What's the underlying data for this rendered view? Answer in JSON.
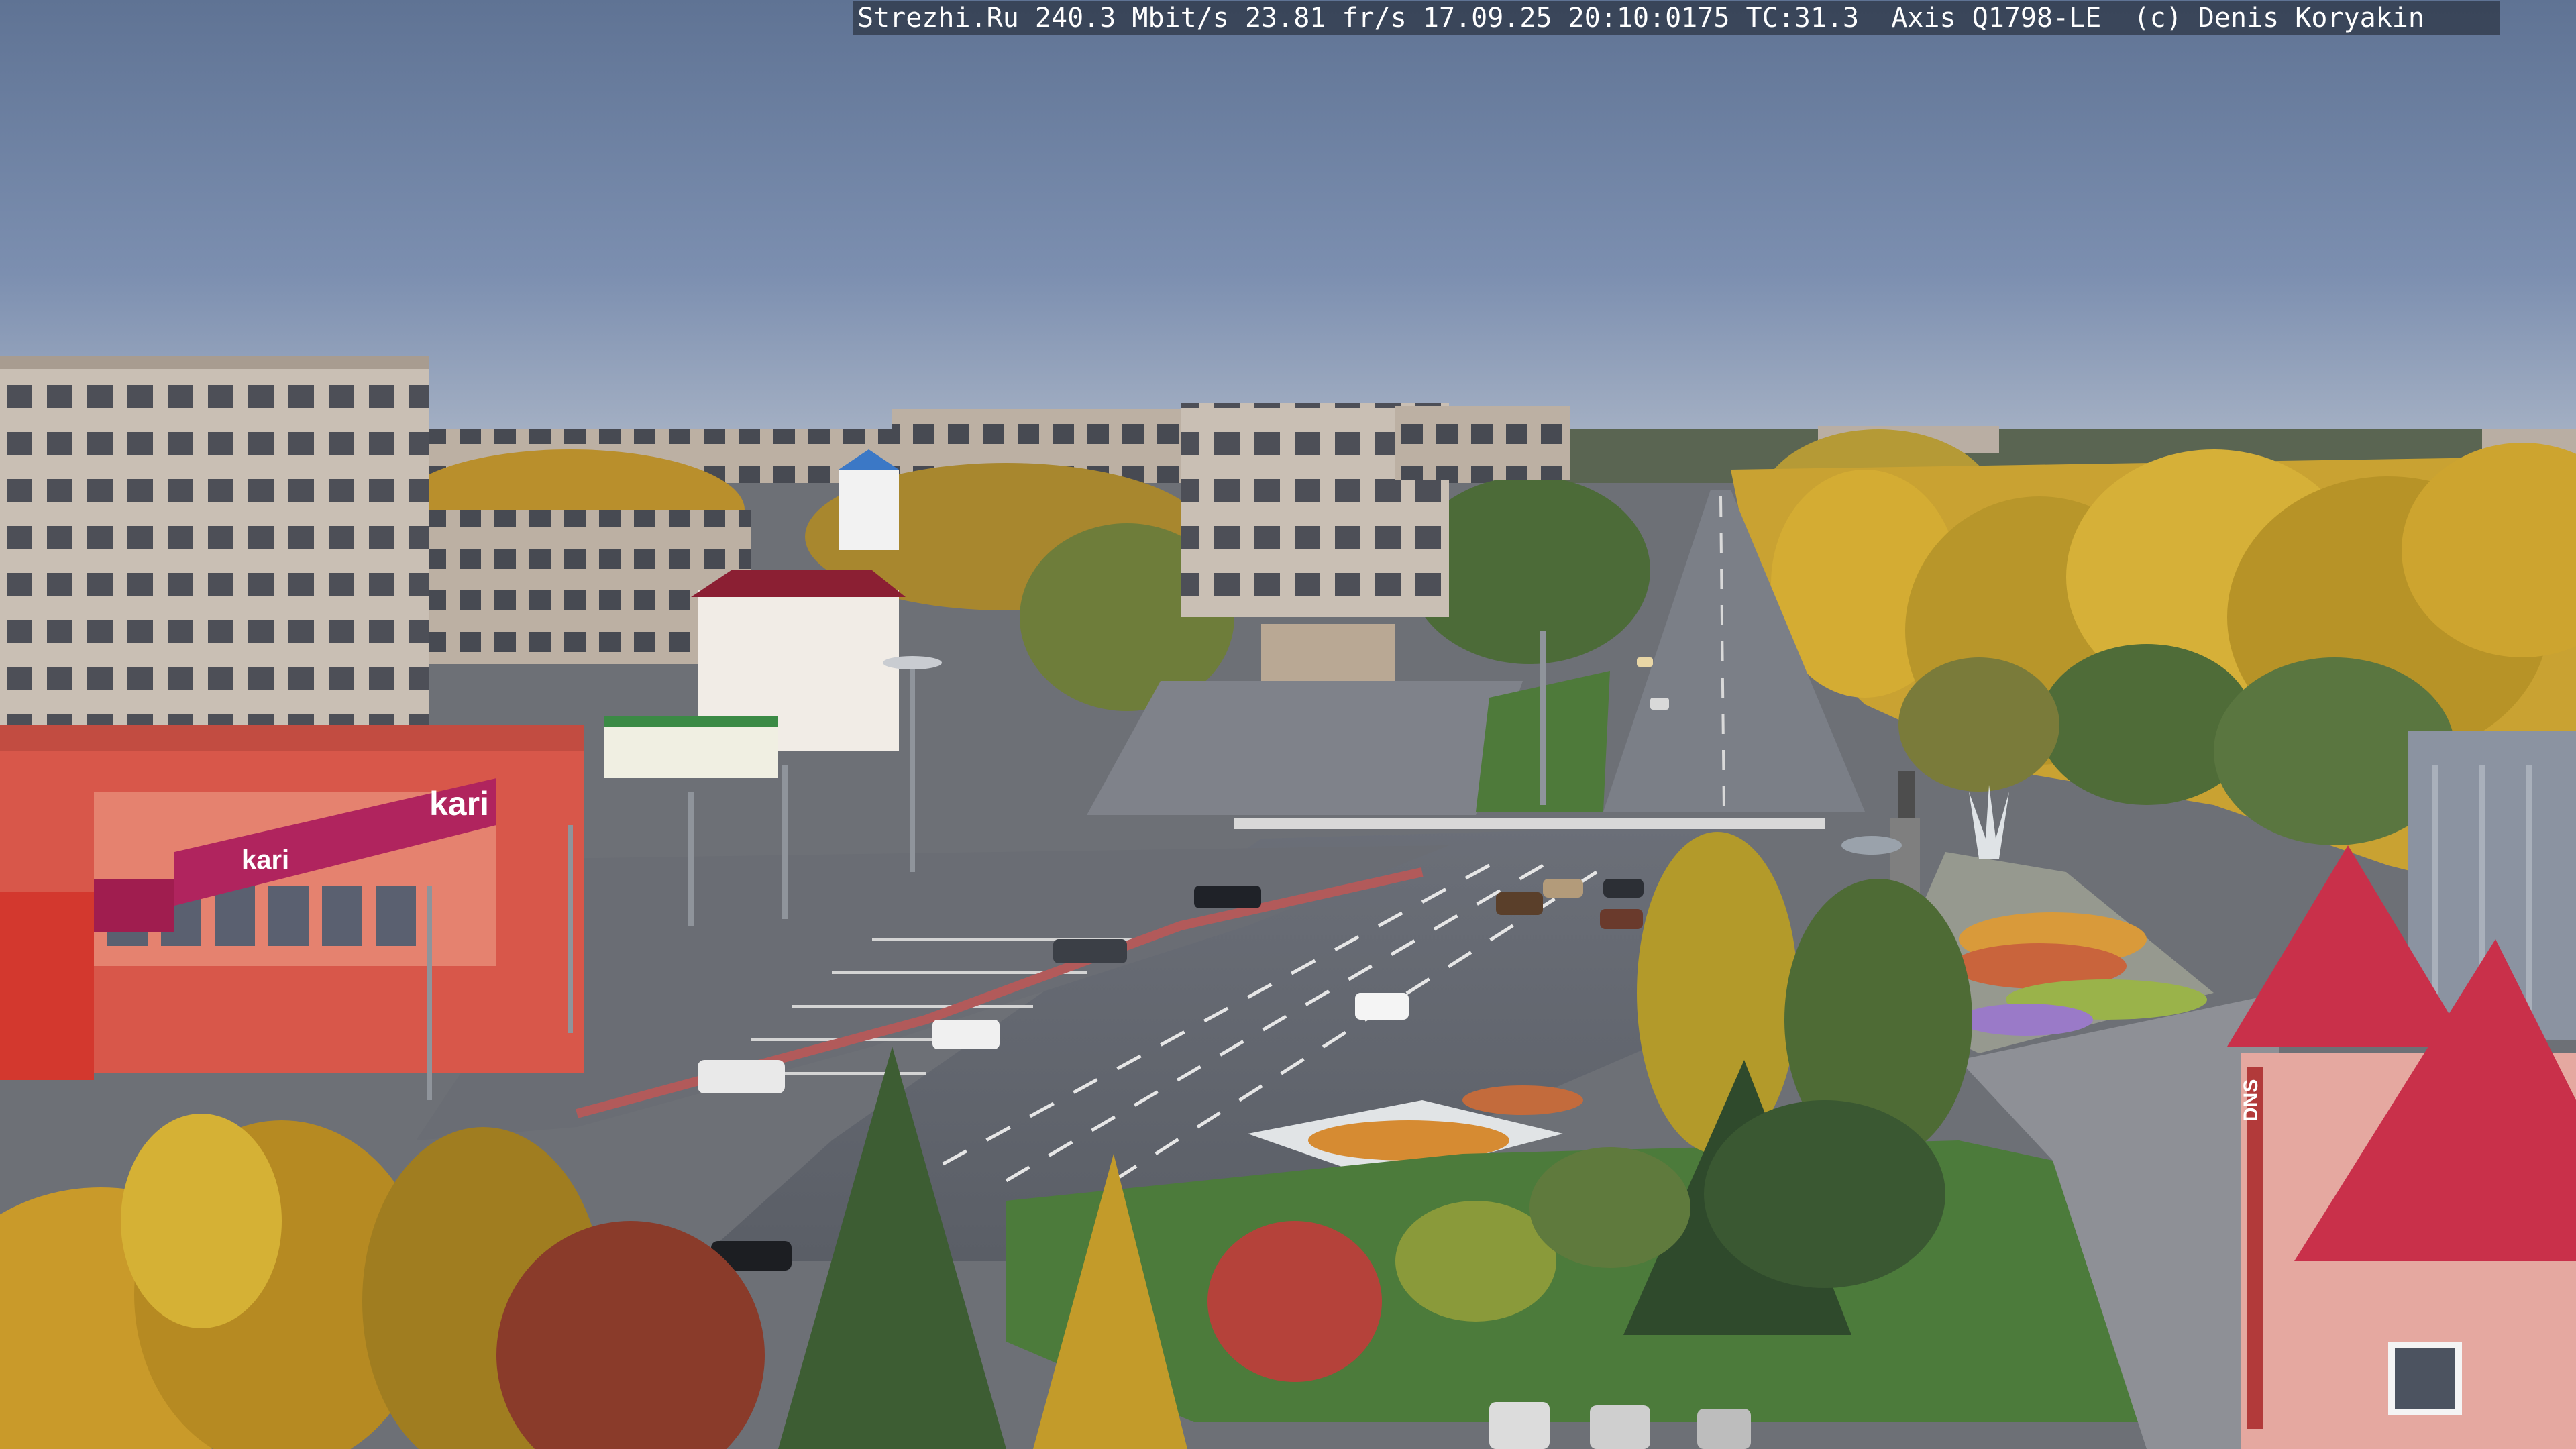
{
  "overlay": {
    "text": "Strezhi.Ru 240.3 Mbit/s 23.81 fr/s 17.09.25 20:10:0175 TC:31.3  Axis Q1798-LE  (c) Denis Koryakin"
  },
  "storefront": {
    "sign_brand": "kari",
    "sign_brand_2": "kari"
  },
  "building_right": {
    "sign": "DNS"
  },
  "colors": {
    "sky_top": "#5f7394",
    "sky_bottom": "#a9b4c6",
    "autumn_yellow": "#c9a232",
    "storefront_red": "#d8574a",
    "sign_magenta": "#b0245e",
    "roof_red": "#c9304a"
  }
}
